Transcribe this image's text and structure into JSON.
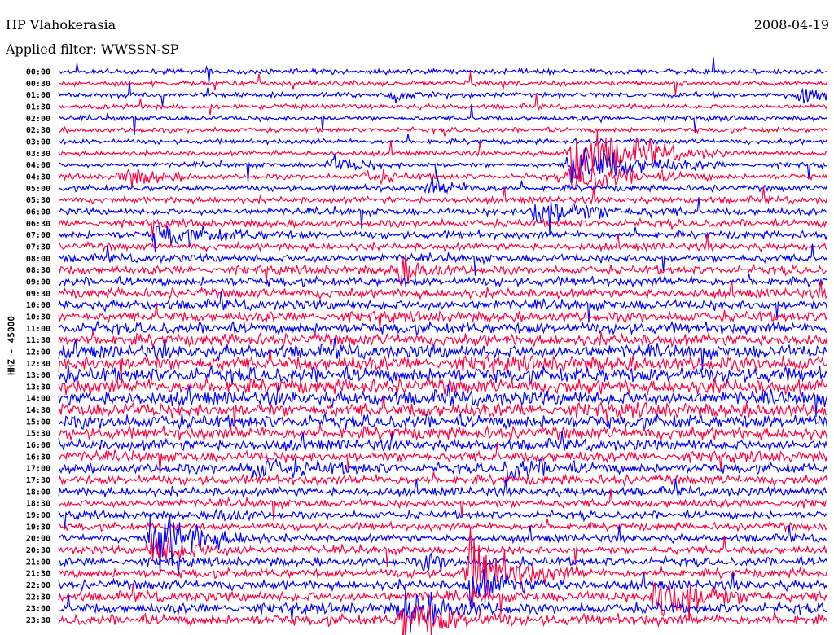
{
  "header": {
    "station": "HP Vlahokerasia",
    "filter": "Applied filter: WWSSN-SP",
    "date": "2008-04-19"
  },
  "chart_data": {
    "type": "line",
    "title": "HP Vlahokerasia",
    "subtitle": "Applied filter: WWSSN-SP",
    "date": "2008-04-19",
    "ylabel": "HHZ - 45000",
    "xlabel": "",
    "minutes_per_line": 30,
    "colors": [
      "#0000ff",
      "#ff0040"
    ],
    "row_labels": [
      "00:00",
      "00:30",
      "01:00",
      "01:30",
      "02:00",
      "02:30",
      "03:00",
      "03:30",
      "04:00",
      "04:30",
      "05:00",
      "05:30",
      "06:00",
      "06:30",
      "07:00",
      "07:30",
      "08:00",
      "08:30",
      "09:00",
      "09:30",
      "10:00",
      "10:30",
      "11:00",
      "11:30",
      "12:00",
      "12:30",
      "13:00",
      "13:30",
      "14:00",
      "14:30",
      "15:00",
      "15:30",
      "16:00",
      "16:30",
      "17:00",
      "17:30",
      "18:00",
      "18:30",
      "19:00",
      "19:30",
      "20:00",
      "20:30",
      "21:00",
      "21:30",
      "22:00",
      "22:30",
      "23:00",
      "23:30"
    ],
    "noise_level": [
      2,
      2,
      2,
      2,
      2,
      2,
      2,
      2,
      2,
      2.2,
      2.4,
      2.6,
      2.8,
      3,
      3,
      3,
      3.2,
      3.4,
      3.6,
      3.8,
      4,
      4.2,
      4.5,
      4.8,
      5.5,
      6,
      6.2,
      6,
      6,
      5.8,
      5.5,
      5,
      4.5,
      4.2,
      4,
      3.8,
      3.5,
      3.2,
      3,
      3,
      3,
      3.2,
      3.4,
      3.6,
      3.8,
      4,
      4.2,
      4.4
    ],
    "events": [
      {
        "row": 2,
        "minute": 29,
        "amp": 10,
        "dur": 1.2
      },
      {
        "row": 2,
        "minute": 13,
        "amp": 6,
        "dur": 1
      },
      {
        "row": 8,
        "minute": 10.6,
        "amp": 8,
        "dur": 1
      },
      {
        "row": 9,
        "minute": 2.5,
        "amp": 9,
        "dur": 1.2
      },
      {
        "row": 9,
        "minute": 12,
        "amp": 6,
        "dur": 1
      },
      {
        "row": 10,
        "minute": 14.5,
        "amp": 8,
        "dur": 1
      },
      {
        "row": 7,
        "minute": 20,
        "amp": 30,
        "dur": 2
      },
      {
        "row": 8,
        "minute": 20,
        "amp": 22,
        "dur": 2
      },
      {
        "row": 9,
        "minute": 20,
        "amp": 14,
        "dur": 2
      },
      {
        "row": 12,
        "minute": 18.5,
        "amp": 14,
        "dur": 2
      },
      {
        "row": 14,
        "minute": 3.7,
        "amp": 10,
        "dur": 2
      },
      {
        "row": 17,
        "minute": 13.2,
        "amp": 12,
        "dur": 1
      },
      {
        "row": 34,
        "minute": 7.5,
        "amp": 8,
        "dur": 2
      },
      {
        "row": 34,
        "minute": 17.5,
        "amp": 8,
        "dur": 1.5
      },
      {
        "row": 38,
        "minute": 6.2,
        "amp": 7,
        "dur": 0.8
      },
      {
        "row": 40,
        "minute": 3.6,
        "amp": 32,
        "dur": 1.5
      },
      {
        "row": 41,
        "minute": 3.6,
        "amp": 14,
        "dur": 1.5
      },
      {
        "row": 42,
        "minute": 14.3,
        "amp": 8,
        "dur": 0.8
      },
      {
        "row": 43,
        "minute": 16,
        "amp": 32,
        "dur": 1.5
      },
      {
        "row": 44,
        "minute": 16,
        "amp": 14,
        "dur": 1.5
      },
      {
        "row": 45,
        "minute": 23.3,
        "amp": 26,
        "dur": 1.5
      },
      {
        "row": 46,
        "minute": 13.4,
        "amp": 18,
        "dur": 1.5
      },
      {
        "row": 47,
        "minute": 13.4,
        "amp": 20,
        "dur": 1.5
      }
    ]
  }
}
